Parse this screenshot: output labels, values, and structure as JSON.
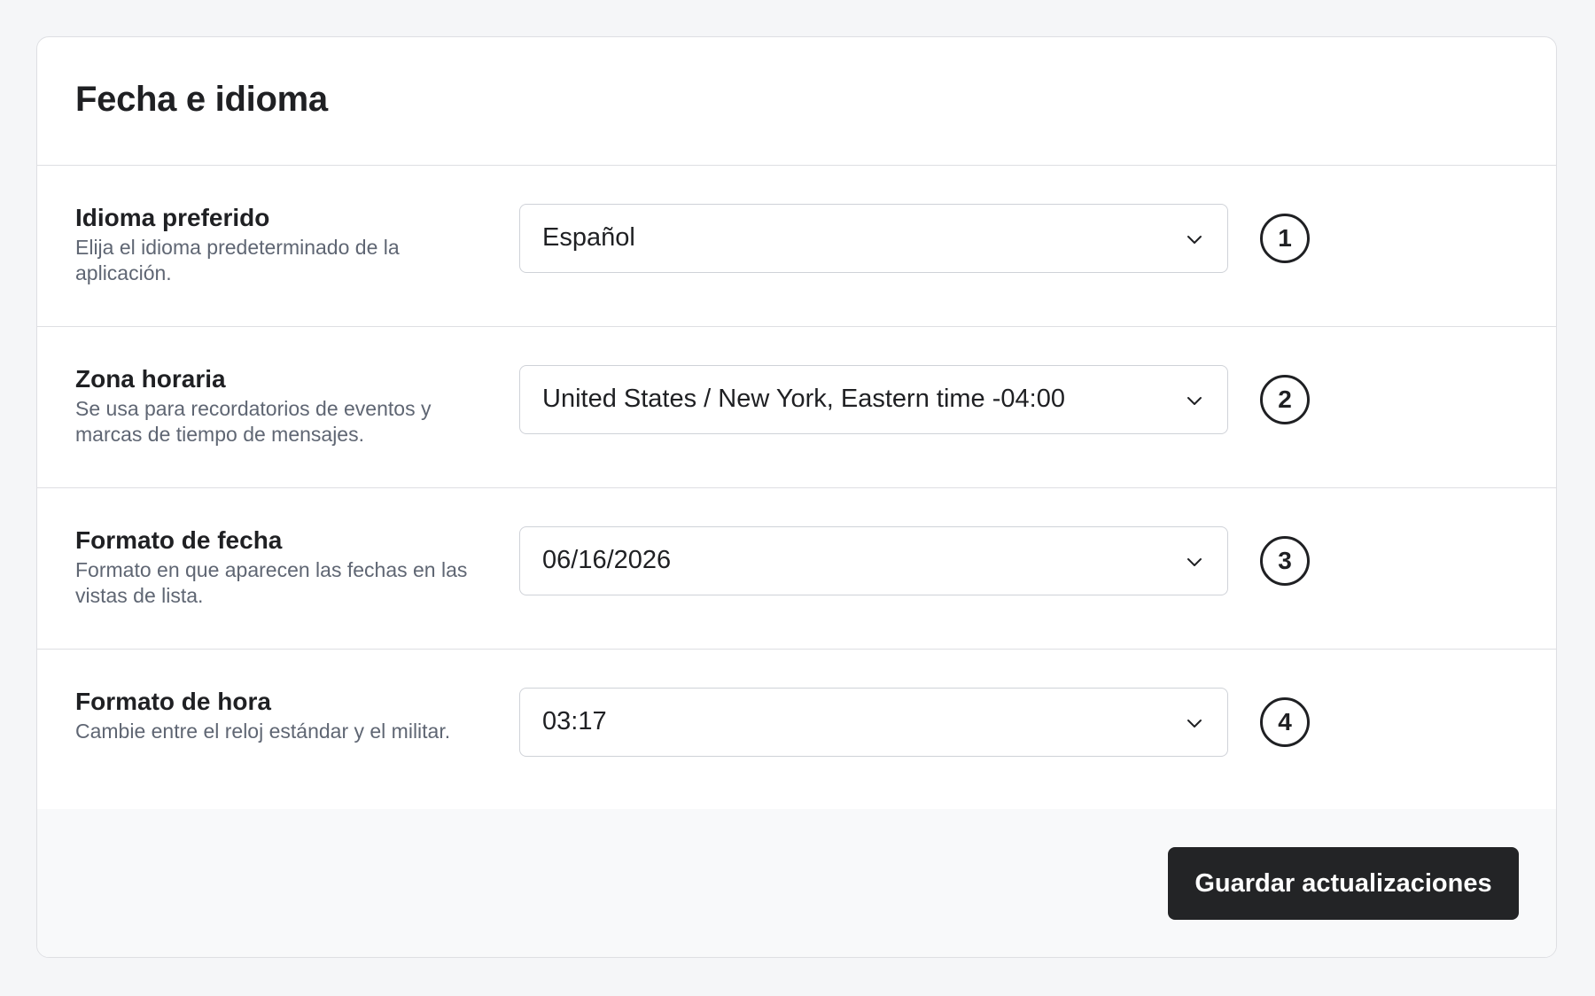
{
  "section": {
    "title": "Fecha e idioma"
  },
  "rows": [
    {
      "label": "Idioma preferido",
      "description": "Elija el idioma predeterminado de la aplicación.",
      "value": "Español",
      "badge": "1",
      "chevron_icon": "chevron-down-icon"
    },
    {
      "label": "Zona horaria",
      "description": "Se usa para recordatorios de eventos y marcas de tiempo de mensajes.",
      "value": "United States / New York, Eastern time -04:00",
      "badge": "2",
      "chevron_icon": "chevron-down-icon"
    },
    {
      "label": "Formato de fecha",
      "description": "Formato en que aparecen las fechas en las vistas de lista.",
      "value": "06/16/2026",
      "badge": "3",
      "chevron_icon": "chevron-down-icon"
    },
    {
      "label": "Formato de hora",
      "description": "Cambie entre el reloj estándar y el militar.",
      "value": "03:17",
      "badge": "4",
      "chevron_icon": "chevron-down-icon"
    }
  ],
  "footer": {
    "save_label": "Guardar actualizaciones"
  },
  "colors": {
    "page_background": "#f5f6f8",
    "card_background": "#ffffff",
    "border": "#dedfe3",
    "text_primary": "#1f2023",
    "text_secondary": "#5f6673",
    "button_background": "#232426",
    "button_text": "#ffffff"
  }
}
